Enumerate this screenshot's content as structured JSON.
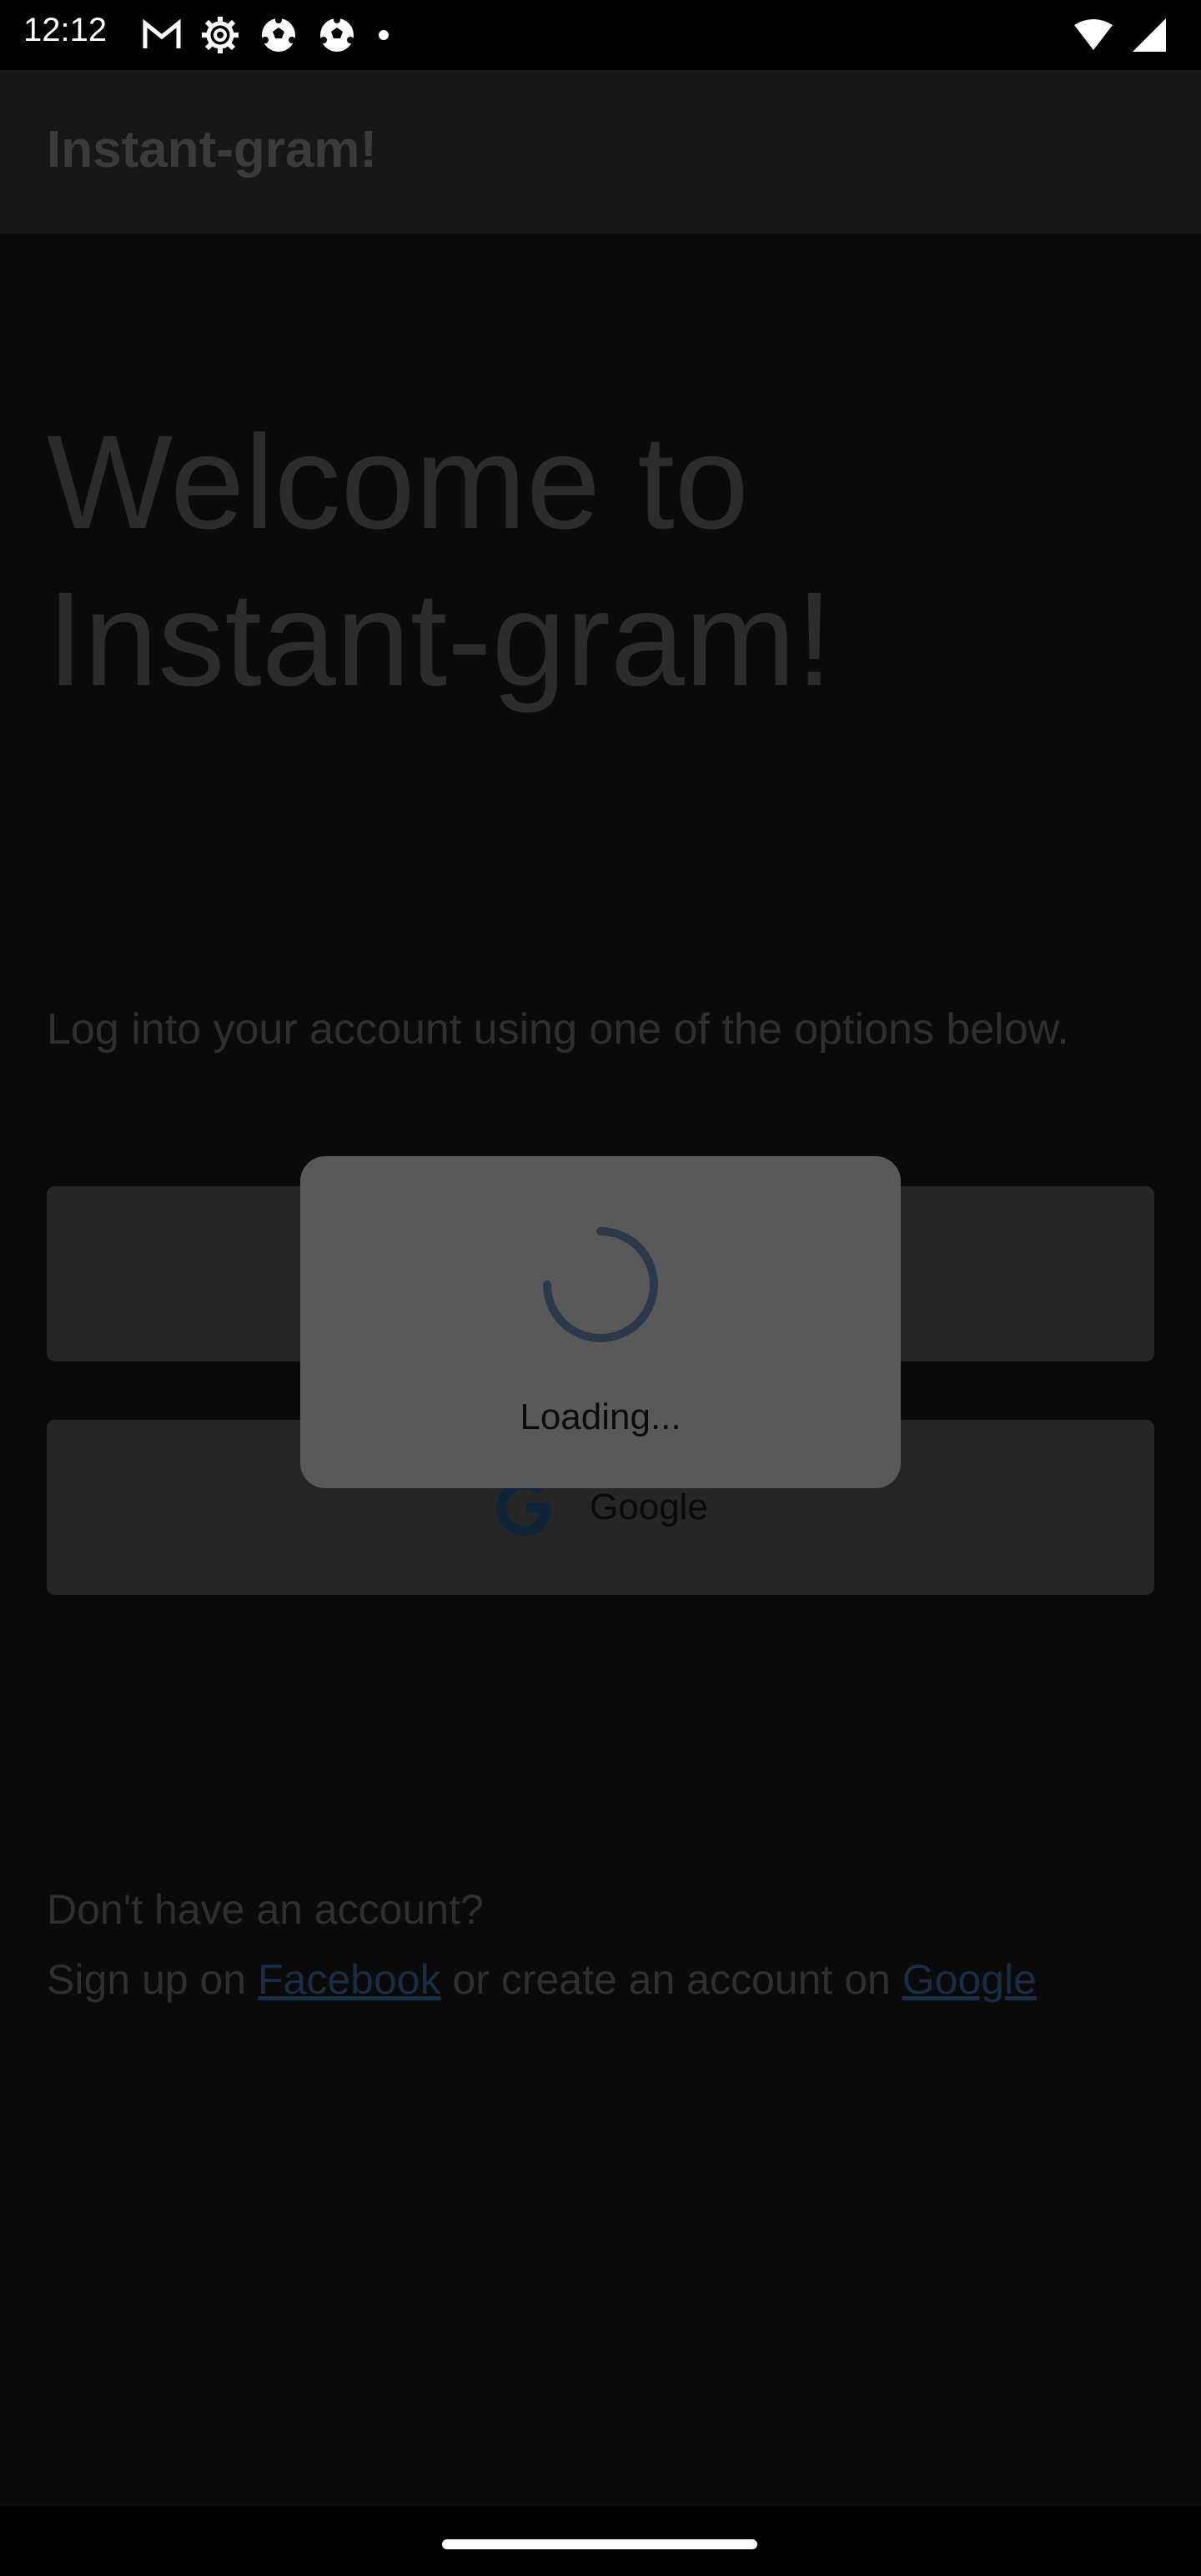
{
  "status_bar": {
    "time": "12:12",
    "icons_left": [
      "gmail-icon",
      "settings-icon",
      "soccer-ball-icon",
      "soccer-ball-icon",
      "dot-icon"
    ],
    "icons_right": [
      "wifi-icon",
      "signal-icon"
    ]
  },
  "appbar": {
    "title": "Instant-gram!"
  },
  "main": {
    "welcome_line1": "Welcome to",
    "welcome_line2": "Instant-gram!",
    "instructions": "Log into your account using one of the options below.",
    "google_button_label": "Google"
  },
  "footer": {
    "question": "Don't have an account?",
    "signup_prefix": "Sign up on ",
    "facebook_link": "Facebook",
    "signup_middle": " or create an account on ",
    "google_link": "Google"
  },
  "dialog": {
    "text": "Loading..."
  },
  "colors": {
    "overlay_background": "#0b0b0b",
    "dialog_background": "#595959",
    "spinner": "#2a3a4c",
    "link": "#1b2d44"
  }
}
